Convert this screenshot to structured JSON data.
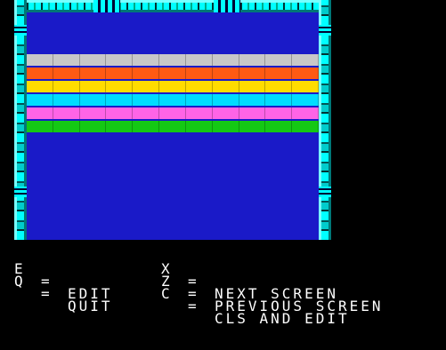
{
  "game": {
    "field_color": "#1a1ac8",
    "border_color": "#00ffff",
    "bricks": {
      "columns": 11,
      "rows": [
        {
          "color": "#c8c8c8"
        },
        {
          "color": "#ff5a14"
        },
        {
          "color": "#ffdc00"
        },
        {
          "color": "#00dcff"
        },
        {
          "color": "#ff64e6"
        },
        {
          "color": "#14c814"
        }
      ]
    }
  },
  "help": {
    "left": [
      {
        "key": "E",
        "eq": "=",
        "action": "EDIT"
      },
      {
        "key": "Q",
        "eq": "=",
        "action": "QUIT"
      }
    ],
    "right": [
      {
        "key": "X",
        "eq": "=",
        "action": "NEXT SCREEN"
      },
      {
        "key": "Z",
        "eq": "=",
        "action": "PREVIOUS SCREEN"
      },
      {
        "key": "C",
        "eq": "=",
        "action": "CLS AND EDIT"
      }
    ]
  }
}
